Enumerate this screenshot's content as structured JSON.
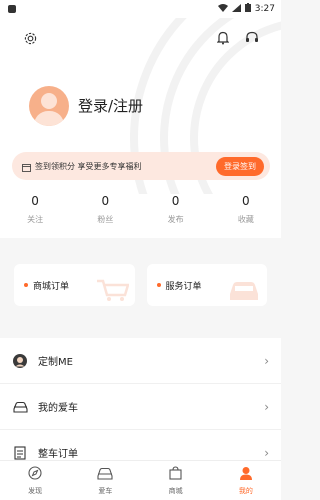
{
  "status_bar": {
    "time": "3:27"
  },
  "profile": {
    "login_label": "登录/注册"
  },
  "signin_banner": {
    "text": "签到领积分 享受更多专享福利",
    "button": "登录签到"
  },
  "stats": [
    {
      "value": "0",
      "label": "关注"
    },
    {
      "value": "0",
      "label": "粉丝"
    },
    {
      "value": "0",
      "label": "发布"
    },
    {
      "value": "0",
      "label": "收藏"
    }
  ],
  "cards": [
    {
      "label": "商城订单"
    },
    {
      "label": "服务订单"
    }
  ],
  "menu": [
    {
      "label": "定制ME",
      "icon": "avatar-icon"
    },
    {
      "label": "我的爱车",
      "icon": "car-icon"
    },
    {
      "label": "整车订单",
      "icon": "order-icon"
    }
  ],
  "tabs": [
    {
      "label": "发现",
      "icon": "compass-icon"
    },
    {
      "label": "爱车",
      "icon": "car-icon"
    },
    {
      "label": "商城",
      "icon": "bag-icon"
    },
    {
      "label": "我的",
      "icon": "person-icon"
    }
  ],
  "colors": {
    "accent": "#ff6a2b",
    "banner_bg": "#fde8e0"
  }
}
